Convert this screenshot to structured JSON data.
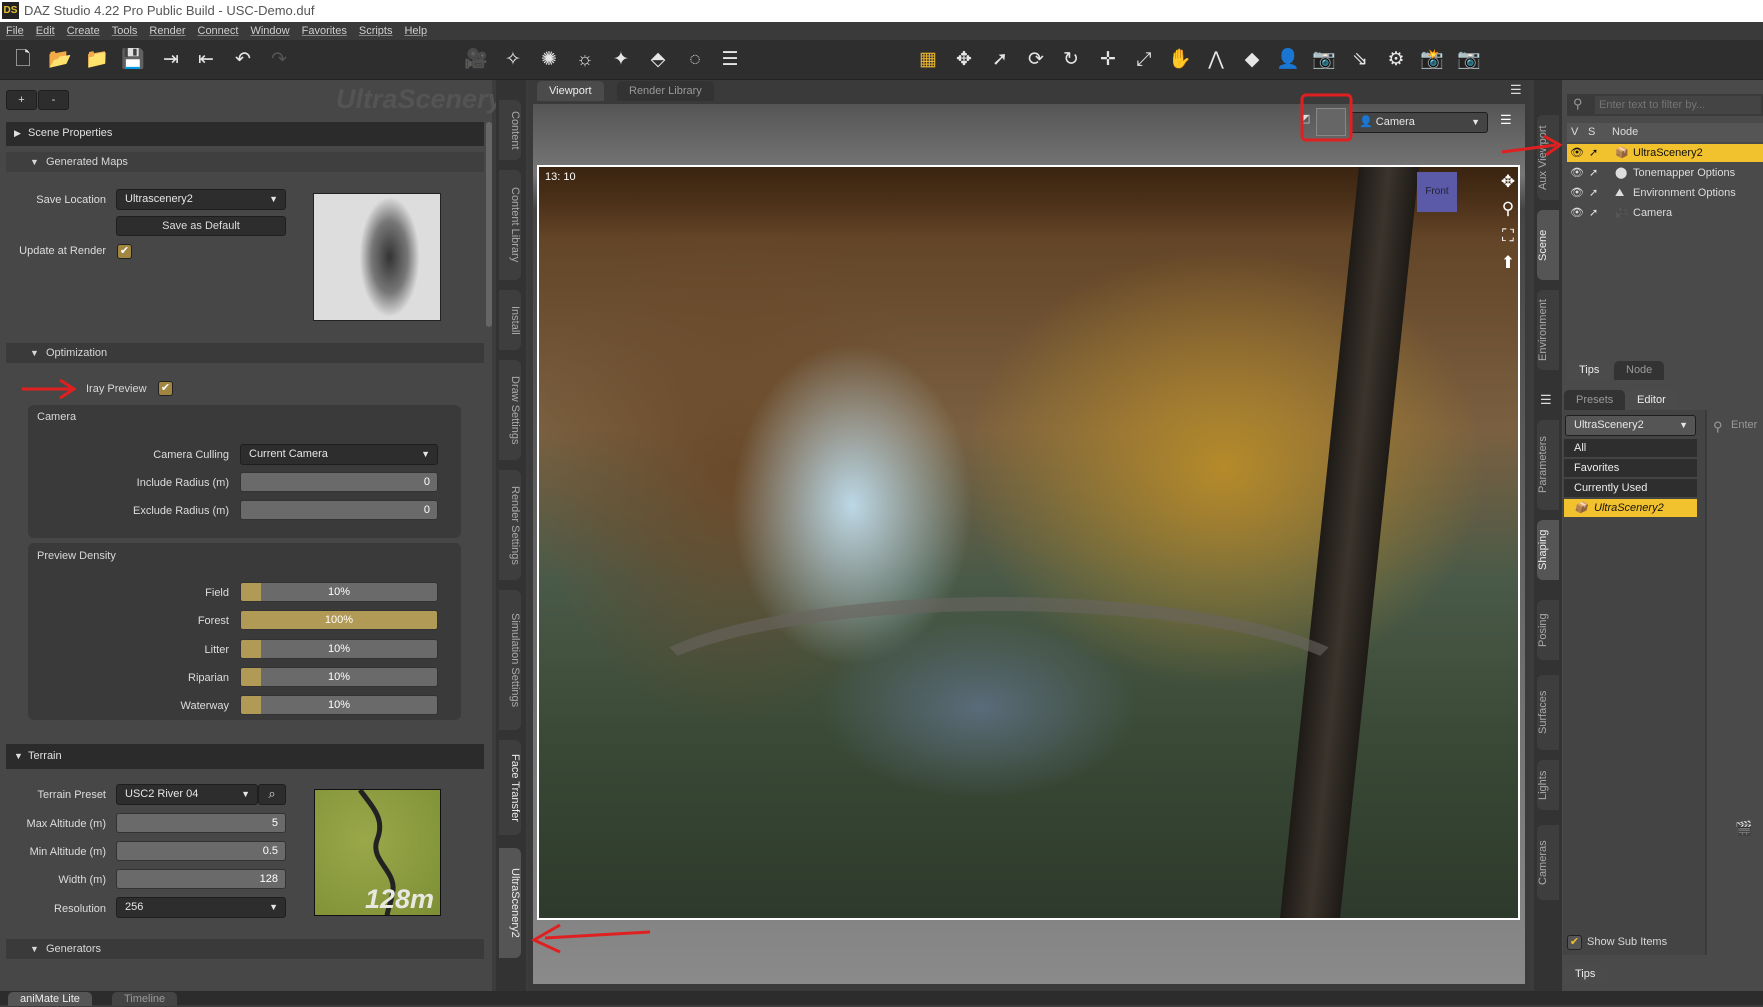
{
  "app": {
    "logo": "DS",
    "title": "DAZ Studio 4.22 Pro Public Build - USC-Demo.duf"
  },
  "menu": [
    "File",
    "Edit",
    "Create",
    "Tools",
    "Render",
    "Connect",
    "Window",
    "Favorites",
    "Scripts",
    "Help"
  ],
  "toolbar_icons": [
    "new-file-icon",
    "open-icon",
    "merge-icon",
    "save-icon",
    "import-icon",
    "export-icon",
    "undo-icon",
    "redo-icon"
  ],
  "left_panel": {
    "plus": "+",
    "minus": "-",
    "watermark": "UltraScenery2",
    "scene_properties": "Scene Properties",
    "generated_maps": "Generated Maps",
    "save_location_label": "Save Location",
    "save_location_value": "Ultrascenery2",
    "save_default": "Save as Default",
    "update_at_render": "Update at Render",
    "optimization": "Optimization",
    "iray_preview": "Iray Preview",
    "camera_group": "Camera",
    "camera_culling_label": "Camera Culling",
    "camera_culling_value": "Current Camera",
    "include_radius_label": "Include Radius (m)",
    "include_radius_value": "0",
    "exclude_radius_label": "Exclude Radius (m)",
    "exclude_radius_value": "0",
    "preview_density": "Preview Density",
    "densities": [
      {
        "label": "Field",
        "value": "10%",
        "fraction": 0.1
      },
      {
        "label": "Forest",
        "value": "100%",
        "fraction": 1.0
      },
      {
        "label": "Litter",
        "value": "10%",
        "fraction": 0.1
      },
      {
        "label": "Riparian",
        "value": "10%",
        "fraction": 0.1
      },
      {
        "label": "Waterway",
        "value": "10%",
        "fraction": 0.1
      }
    ],
    "terrain": "Terrain",
    "terrain_preset_label": "Terrain Preset",
    "terrain_preset_value": "USC2 River 04",
    "max_alt_label": "Max Altitude (m)",
    "max_alt_value": "5",
    "min_alt_label": "Min Altitude (m)",
    "min_alt_value": "0.5",
    "width_label": "Width (m)",
    "width_value": "128",
    "resolution_label": "Resolution",
    "resolution_value": "256",
    "terrain_thumb_text": "128m",
    "generators": "Generators"
  },
  "left_tabs": [
    "Content",
    "Content Library",
    "Install",
    "Draw Settings",
    "Render Settings",
    "Simulation Settings",
    "Face Transfer",
    "UltraScenery2"
  ],
  "viewport": {
    "tabs": [
      "Viewport",
      "Render Library"
    ],
    "camera": "Camera",
    "aspect": "13: 10",
    "cube_label": "Front"
  },
  "right_tabs_top": [
    "Aux Viewport",
    "Scene",
    "Environment"
  ],
  "right_tabs_bottom": [
    "Parameters",
    "Shaping",
    "Posing",
    "Surfaces",
    "Lights",
    "Cameras"
  ],
  "scene": {
    "filter_placeholder": "Enter text to filter by...",
    "cols": [
      "V",
      "S",
      "Node"
    ],
    "nodes": [
      "UltraScenery2",
      "Tonemapper Options",
      "Environment Options",
      "Camera"
    ],
    "tabs": [
      "Tips",
      "Node"
    ]
  },
  "shaping": {
    "tabs": [
      "Presets",
      "Editor"
    ],
    "dropdown": "UltraScenery2",
    "list": [
      "All",
      "Favorites",
      "Currently Used",
      "UltraScenery2"
    ],
    "search_placeholder": "Enter",
    "show_sub_items": "Show Sub Items",
    "bottom_tab": "Tips"
  },
  "bottom_tabs": [
    "aniMate Lite",
    "Timeline"
  ],
  "colors": {
    "accent": "#f2c12e",
    "annotation": "#e02020"
  }
}
